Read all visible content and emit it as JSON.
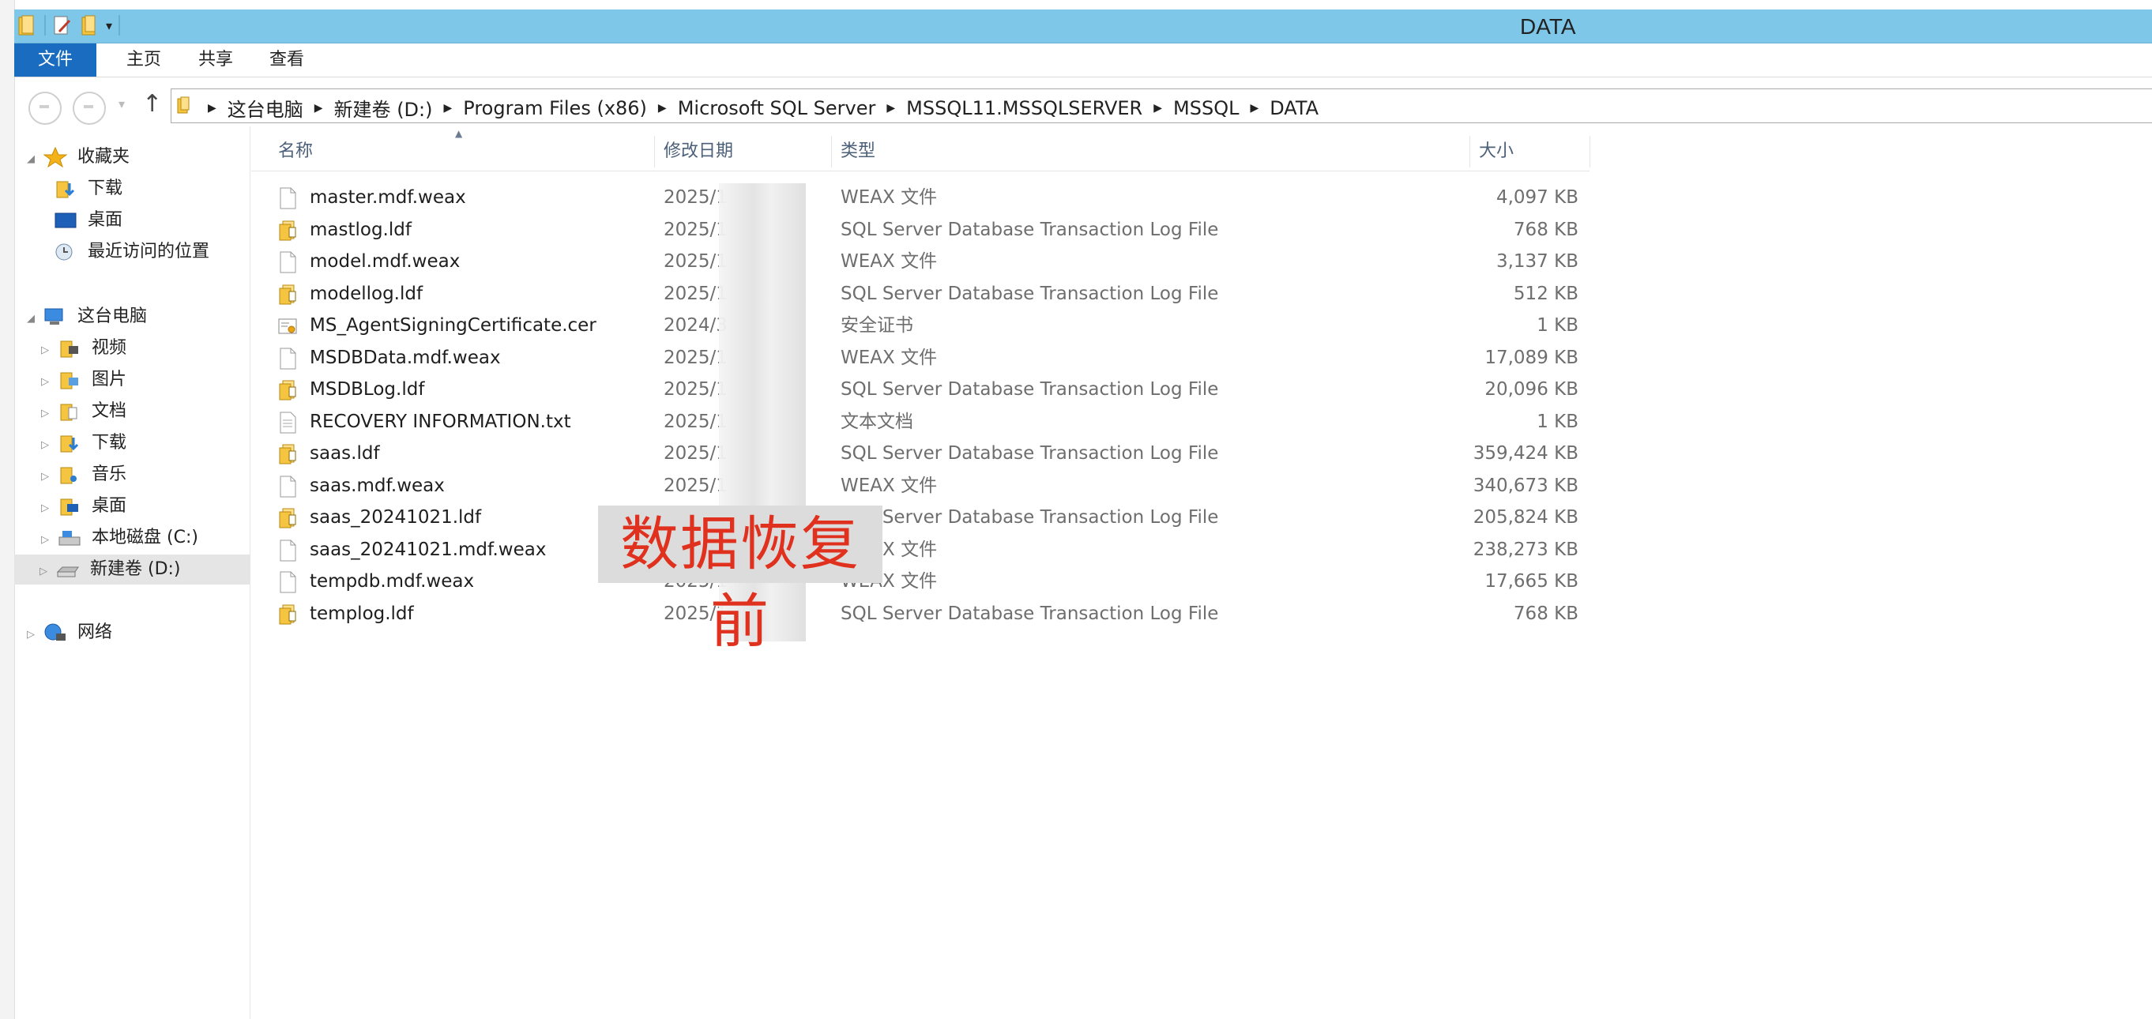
{
  "window": {
    "title": "DATA"
  },
  "ribbon": {
    "file": "文件",
    "tabs": [
      "主页",
      "共享",
      "查看"
    ]
  },
  "address": {
    "crumbs": [
      "这台电脑",
      "新建卷 (D:)",
      "Program Files (x86)",
      "Microsoft SQL Server",
      "MSSQL11.MSSQLSERVER",
      "MSSQL",
      "DATA"
    ]
  },
  "navpane": {
    "favorites": "收藏夹",
    "fav_items": [
      "下载",
      "桌面",
      "最近访问的位置"
    ],
    "thispc": "这台电脑",
    "pc_items": [
      "视频",
      "图片",
      "文档",
      "下载",
      "音乐",
      "桌面",
      "本地磁盘 (C:)",
      "新建卷 (D:)"
    ],
    "network": "网络"
  },
  "columns": {
    "name": "名称",
    "date": "修改日期",
    "type": "类型",
    "size": "大小"
  },
  "files": [
    {
      "name": "master.mdf.weax",
      "date": "2025/1",
      "type": "WEAX 文件",
      "size": "4,097 KB",
      "icon": "blank-file-icon"
    },
    {
      "name": "mastlog.ldf",
      "date": "2025/1",
      "type": "SQL Server Database Transaction Log File",
      "size": "768 KB",
      "icon": "log-file-icon"
    },
    {
      "name": "model.mdf.weax",
      "date": "2025/1",
      "type": "WEAX 文件",
      "size": "3,137 KB",
      "icon": "blank-file-icon"
    },
    {
      "name": "modellog.ldf",
      "date": "2025/1",
      "type": "SQL Server Database Transaction Log File",
      "size": "512 KB",
      "icon": "log-file-icon"
    },
    {
      "name": "MS_AgentSigningCertificate.cer",
      "date": "2024/3",
      "type": "安全证书",
      "size": "1 KB",
      "icon": "certificate-icon"
    },
    {
      "name": "MSDBData.mdf.weax",
      "date": "2025/1",
      "type": "WEAX 文件",
      "size": "17,089 KB",
      "icon": "blank-file-icon"
    },
    {
      "name": "MSDBLog.ldf",
      "date": "2025/1",
      "type": "SQL Server Database Transaction Log File",
      "size": "20,096 KB",
      "icon": "log-file-icon"
    },
    {
      "name": "RECOVERY INFORMATION.txt",
      "date": "2025/1",
      "type": "文本文档",
      "size": "1 KB",
      "icon": "text-file-icon"
    },
    {
      "name": "saas.ldf",
      "date": "2025/1",
      "type": "SQL Server Database Transaction Log File",
      "size": "359,424 KB",
      "icon": "log-file-icon"
    },
    {
      "name": "saas.mdf.weax",
      "date": "2025/1",
      "type": "WEAX 文件",
      "size": "340,673 KB",
      "icon": "blank-file-icon"
    },
    {
      "name": "saas_20241021.ldf",
      "date": "2025/1",
      "type": "SQL Server Database Transaction Log File",
      "size": "205,824 KB",
      "icon": "log-file-icon"
    },
    {
      "name": "saas_20241021.mdf.weax",
      "date": "2025/1",
      "type": "WEAX 文件",
      "size": "238,273 KB",
      "icon": "blank-file-icon"
    },
    {
      "name": "tempdb.mdf.weax",
      "date": "2025/1",
      "type": "WEAX 文件",
      "size": "17,665 KB",
      "icon": "blank-file-icon"
    },
    {
      "name": "templog.ldf",
      "date": "2025/1",
      "type": "SQL Server Database Transaction Log File",
      "size": "768 KB",
      "icon": "log-file-icon"
    }
  ],
  "overlay": {
    "text": "数据恢复前"
  },
  "colors": {
    "titlebar": "#7fc7e9",
    "file_tab": "#1a6cc0",
    "overlay_text": "#e0301e"
  }
}
